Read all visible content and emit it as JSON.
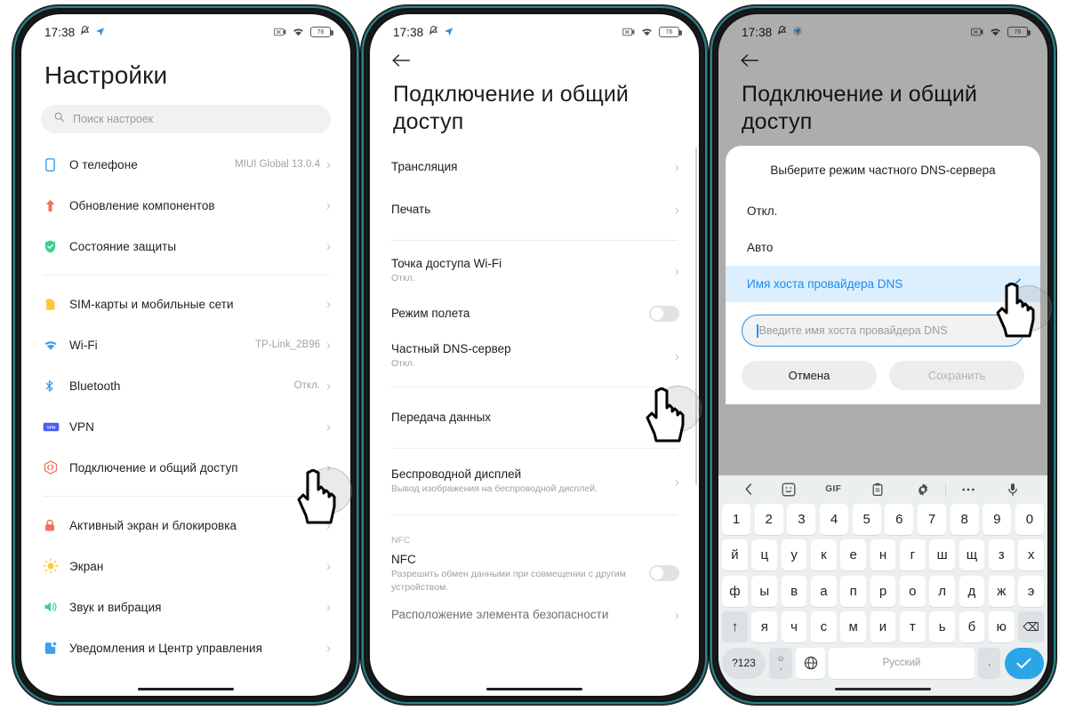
{
  "status_bar": {
    "time": "17:38",
    "battery_percent": "76",
    "icons": [
      "mute-icon",
      "location-icon",
      "camera-blocked-icon",
      "wifi-icon",
      "battery-icon"
    ]
  },
  "phone1": {
    "title": "Настройки",
    "search": {
      "placeholder": "Поиск настроек",
      "icon": "search-icon"
    },
    "groups": [
      {
        "items": [
          {
            "icon": "phone-info-icon",
            "label": "О телефоне",
            "value": "MIUI Global 13.0.4",
            "chevron": "›"
          },
          {
            "icon": "update-icon",
            "label": "Обновление компонентов",
            "value": "",
            "chevron": "›"
          },
          {
            "icon": "shield-icon",
            "label": "Состояние защиты",
            "value": "",
            "chevron": "›"
          }
        ]
      },
      {
        "items": [
          {
            "icon": "sim-card-icon",
            "label": "SIM-карты и мобильные сети",
            "value": "",
            "chevron": "›"
          },
          {
            "icon": "wifi-icon",
            "label": "Wi-Fi",
            "value": "TP-Link_2B96",
            "chevron": "›"
          },
          {
            "icon": "bluetooth-icon",
            "label": "Bluetooth",
            "value": "Откл.",
            "chevron": "›"
          },
          {
            "icon": "vpn-icon",
            "label": "VPN",
            "value": "",
            "chevron": "›"
          },
          {
            "icon": "connection-sharing-icon",
            "label": "Подключение и общий доступ",
            "value": "",
            "chevron": "›"
          }
        ]
      },
      {
        "items": [
          {
            "icon": "lock-icon",
            "label": "Активный экран и блокировка",
            "value": "",
            "chevron": "›"
          },
          {
            "icon": "brightness-icon",
            "label": "Экран",
            "value": "",
            "chevron": "›"
          },
          {
            "icon": "sound-icon",
            "label": "Звук и вибрация",
            "value": "",
            "chevron": "›"
          },
          {
            "icon": "notification-icon",
            "label": "Уведомления и Центр управления",
            "value": "",
            "chevron": "›"
          }
        ]
      }
    ]
  },
  "phone2": {
    "back_icon": "back-arrow-icon",
    "title": "Подключение и общий доступ",
    "groups": [
      {
        "items": [
          {
            "label": "Трансляция",
            "sub": "",
            "control": "chevron",
            "chevron": "›"
          },
          {
            "label": "Печать",
            "sub": "",
            "control": "chevron",
            "chevron": "›"
          }
        ]
      },
      {
        "items": [
          {
            "label": "Точка доступа Wi-Fi",
            "sub": "Откл.",
            "control": "chevron",
            "chevron": "›"
          },
          {
            "label": "Режим полета",
            "sub": "",
            "control": "toggle",
            "toggle_on": false
          },
          {
            "label": "Частный DNS-сервер",
            "sub": "Откл.",
            "control": "chevron",
            "chevron": "›"
          }
        ]
      },
      {
        "items": [
          {
            "label": "Передача данных",
            "sub": "",
            "control": "chevron",
            "chevron": "›"
          }
        ]
      },
      {
        "items": [
          {
            "label": "Беспроводной дисплей",
            "sub": "Вывод изображения на беспроводной дисплей.",
            "control": "chevron",
            "chevron": "›"
          }
        ]
      }
    ],
    "nfc_section_label": "NFC",
    "nfc_item": {
      "label": "NFC",
      "sub": "Разрешить обмен данными при совмещении с другим устройством.",
      "control": "toggle",
      "toggle_on": false
    },
    "last_item": {
      "label": "Расположение элемента безопасности",
      "chevron": "›"
    }
  },
  "phone3": {
    "back_icon": "back-arrow-icon",
    "title": "Подключение и общий доступ",
    "dialog": {
      "title": "Выберите режим частного DNS-сервера",
      "options": [
        {
          "label": "Откл.",
          "selected": false
        },
        {
          "label": "Авто",
          "selected": false
        },
        {
          "label": "Имя хоста провайдера DNS",
          "selected": true,
          "check_icon": "check-icon"
        }
      ],
      "input": {
        "value": "",
        "placeholder": "Введите имя хоста провайдера DNS"
      },
      "cancel_label": "Отмена",
      "save_label": "Сохранить"
    },
    "keyboard": {
      "toolbar_icons": [
        "chevron-left-icon",
        "sticker-icon",
        "gif-icon",
        "clipboard-icon",
        "gear-icon",
        "more-icon",
        "microphone-icon"
      ],
      "gif_label": "GIF",
      "rows": [
        [
          "1",
          "2",
          "3",
          "4",
          "5",
          "6",
          "7",
          "8",
          "9",
          "0"
        ],
        [
          "й",
          "ц",
          "у",
          "к",
          "е",
          "н",
          "г",
          "ш",
          "щ",
          "з",
          "х"
        ],
        [
          "ф",
          "ы",
          "в",
          "а",
          "п",
          "р",
          "о",
          "л",
          "д",
          "ж",
          "э"
        ],
        [
          "↑",
          "я",
          "ч",
          "с",
          "м",
          "и",
          "т",
          "ь",
          "б",
          "ю",
          "⌫"
        ]
      ],
      "bottom": {
        "symbols_label": "?123",
        "emoji_label": "☺",
        "comma_label": ",",
        "globe_icon": "globe-icon",
        "space_label": "Русский",
        "period_label": ".",
        "enter_icon": "check-icon"
      }
    }
  },
  "colors": {
    "accent_blue": "#2b8fe8",
    "selected_row_bg": "#ddeefc",
    "enter_key": "#2aa5e8",
    "icon_red": "#f2705a",
    "icon_green": "#3ecf8e",
    "icon_yellow": "#fdc93b",
    "icon_blue": "#3aa0f0",
    "icon_orange": "#f5a623",
    "frame_teal": "#2a96a0"
  },
  "cursors": [
    {
      "name": "cursor-phone1-connection-sharing"
    },
    {
      "name": "cursor-phone2-private-dns"
    },
    {
      "name": "cursor-phone3-dns-hostname"
    }
  ]
}
